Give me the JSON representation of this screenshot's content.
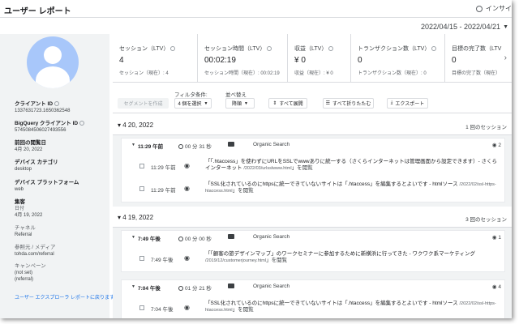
{
  "header": {
    "title": "ユーザー レポート",
    "insight_label": "インサイ"
  },
  "date_range": "2022/04/15 - 2022/04/21",
  "sidebar": {
    "fields": [
      {
        "label": "クライアント ID",
        "value": "1337631723.1650362548"
      },
      {
        "label": "BigQuery クライアント ID",
        "value": "5745084506027493556"
      },
      {
        "label": "前回の閲覧日",
        "value": "4月 20, 2022"
      },
      {
        "label": "デバイス カテゴリ",
        "value": "desktop"
      },
      {
        "label": "デバイス プラットフォーム",
        "value": "web"
      }
    ],
    "acquisition": {
      "heading": "集客",
      "date_label": "日付",
      "date_value": "4月 19, 2022",
      "channel_label": "チャネル",
      "channel_value": "Referral",
      "source_label": "参照元 / メディア",
      "source_value": "tohda.com/referral",
      "campaign_label": "キャンペーン",
      "campaign_value1": "(not set)",
      "campaign_value2": "(referral)"
    },
    "back_link": "ユーザー エクスプローラ レポートに戻ります"
  },
  "metrics": [
    {
      "label": "セッション（LTV）",
      "value": "4",
      "sub": "セッション（現在）: 4"
    },
    {
      "label": "セッション時間（LTV）",
      "value": "00:02:19",
      "sub": "セッション時間（現在）: 00:02:19"
    },
    {
      "label": "収益（LTV）",
      "value": "¥ 0",
      "sub": "収益（現在）: ¥ 0"
    },
    {
      "label": "トランザクション数（LTV）",
      "value": "0",
      "sub": "トランザクション数（現在）: 0"
    },
    {
      "label": "目標の完了数（LTV",
      "value": "0",
      "sub": "目標の完了数（現在）"
    }
  ],
  "controls": {
    "segment_button": "セグメントを作成",
    "filter_label": "フィルタ条件:",
    "filter_value": "4 個を選択",
    "sort_label": "並べ替え",
    "sort_value": "降順",
    "expand_all": "すべて展開",
    "collapse_all": "すべて折りたたむ",
    "export": "エクスポート"
  },
  "days": [
    {
      "date": "4 20, 2022",
      "count": "1 回のセッション",
      "sessions": [
        {
          "time": "11:29 午前",
          "duration": "00 分 31 秒",
          "source": "Organic Search",
          "views": "2",
          "events": [
            {
              "time": "11:29 午前",
              "text": "「「.htaccess」を使わずにURLをSSLでwwwありに統一する（さくらインターネットは管理画面から設定できます）- さくらインターネット",
              "url": "/2022/03/urlsslwww.html",
              "suffix": "」を閲覧"
            },
            {
              "time": "11:29 午前",
              "text": "「SSL化されているのにhttpsに統一できていないサイトは「.htaccess」を編集するとよいです - htmlソース",
              "url": "/2022/02/ssl-https-htaccess.html",
              "suffix": "」を閲覧"
            }
          ]
        }
      ]
    },
    {
      "date": "4 19, 2022",
      "count": "3 回のセッション",
      "sessions": [
        {
          "time": "7:49 午後",
          "duration": "00 分 00 秒",
          "source": "Organic Search",
          "views": "1",
          "events": [
            {
              "time": "7:49 午後",
              "text": "「「顧客の旅デザインマップ」のワークセミナーに参加するために新横浜に行ってきた - ワクワク系マーケティング",
              "url": "/2019/12/customerjourney.html",
              "suffix": "」を閲覧"
            }
          ]
        },
        {
          "time": "7:04 午後",
          "duration": "01 分 21 秒",
          "source": "Organic Search",
          "views": "4",
          "events": [
            {
              "time": "7:04 午後",
              "text": "「SSL化されているのにhttpsに統一できていないサイトは「.htaccess」を編集するとよいです - htmlソース",
              "url": "/2022/02/ssl-https-htaccess.html",
              "suffix": "」を閲覧"
            }
          ]
        }
      ]
    }
  ]
}
